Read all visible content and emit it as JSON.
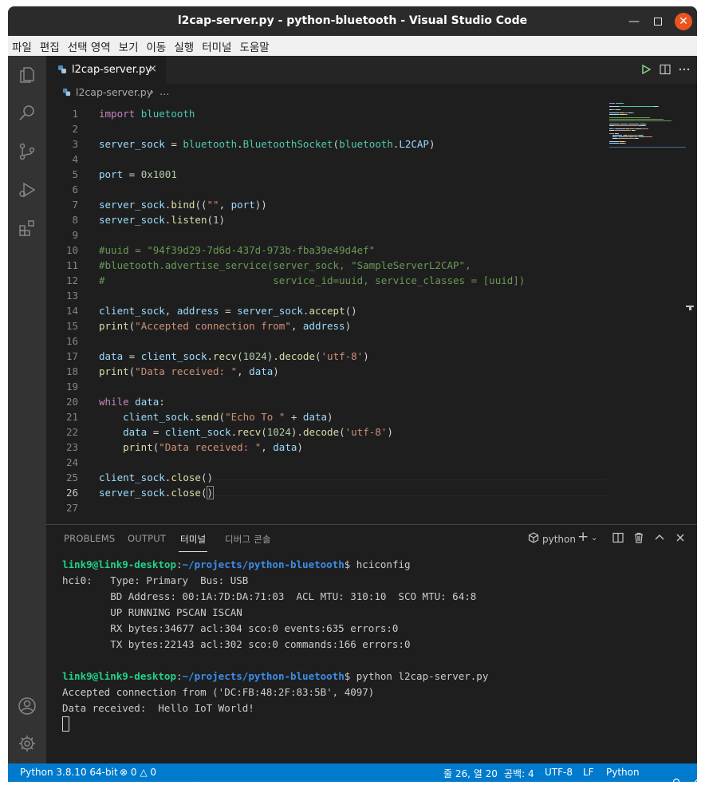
{
  "window": {
    "title": "l2cap-server.py - python-bluetooth - Visual Studio Code"
  },
  "menu": [
    "파일",
    "편집",
    "선택 영역",
    "보기",
    "이동",
    "실행",
    "터미널",
    "도움말"
  ],
  "activity_bar": [
    "files-icon",
    "search-icon",
    "source-control-icon",
    "run-debug-icon",
    "extensions-icon",
    "account-icon",
    "settings-gear-icon"
  ],
  "tab": {
    "label": "l2cap-server.py",
    "close": "×"
  },
  "breadcrumb": {
    "file": "l2cap-server.py",
    "separator": "›",
    "more": "…"
  },
  "editor": {
    "lines": [
      [
        [
          "k",
          "import"
        ],
        [
          "p",
          " "
        ],
        [
          "m",
          "bluetooth"
        ]
      ],
      [],
      [
        [
          "v",
          "server_sock"
        ],
        [
          "p",
          " = "
        ],
        [
          "m",
          "bluetooth"
        ],
        [
          "p",
          "."
        ],
        [
          "m",
          "BluetoothSocket"
        ],
        [
          "p",
          "("
        ],
        [
          "m",
          "bluetooth"
        ],
        [
          "p",
          "."
        ],
        [
          "v",
          "L2CAP"
        ],
        [
          "p",
          ")"
        ]
      ],
      [],
      [
        [
          "v",
          "port"
        ],
        [
          "p",
          " = "
        ],
        [
          "n",
          "0x1001"
        ]
      ],
      [],
      [
        [
          "v",
          "server_sock"
        ],
        [
          "p",
          "."
        ],
        [
          "f",
          "bind"
        ],
        [
          "p",
          "(("
        ],
        [
          "s",
          "\"\""
        ],
        [
          "p",
          ", "
        ],
        [
          "v",
          "port"
        ],
        [
          "p",
          "))"
        ]
      ],
      [
        [
          "v",
          "server_sock"
        ],
        [
          "p",
          "."
        ],
        [
          "f",
          "listen"
        ],
        [
          "p",
          "("
        ],
        [
          "n",
          "1"
        ],
        [
          "p",
          ")"
        ]
      ],
      [],
      [
        [
          "c",
          "#uuid = \"94f39d29-7d6d-437d-973b-fba39e49d4ef\""
        ]
      ],
      [
        [
          "c",
          "#bluetooth.advertise_service(server_sock, \"SampleServerL2CAP\","
        ]
      ],
      [
        [
          "c",
          "#                            service_id=uuid, service_classes = [uuid])"
        ]
      ],
      [],
      [
        [
          "v",
          "client_sock"
        ],
        [
          "p",
          ", "
        ],
        [
          "v",
          "address"
        ],
        [
          "p",
          " = "
        ],
        [
          "v",
          "server_sock"
        ],
        [
          "p",
          "."
        ],
        [
          "f",
          "accept"
        ],
        [
          "p",
          "()"
        ]
      ],
      [
        [
          "f",
          "print"
        ],
        [
          "p",
          "("
        ],
        [
          "s",
          "\"Accepted connection from\""
        ],
        [
          "p",
          ", "
        ],
        [
          "v",
          "address"
        ],
        [
          "p",
          ")"
        ]
      ],
      [],
      [
        [
          "v",
          "data"
        ],
        [
          "p",
          " = "
        ],
        [
          "v",
          "client_sock"
        ],
        [
          "p",
          "."
        ],
        [
          "f",
          "recv"
        ],
        [
          "p",
          "("
        ],
        [
          "n",
          "1024"
        ],
        [
          "p",
          ")."
        ],
        [
          "f",
          "decode"
        ],
        [
          "p",
          "("
        ],
        [
          "s",
          "'utf-8'"
        ],
        [
          "p",
          ")"
        ]
      ],
      [
        [
          "f",
          "print"
        ],
        [
          "p",
          "("
        ],
        [
          "s",
          "\"Data received: \""
        ],
        [
          "p",
          ", "
        ],
        [
          "v",
          "data"
        ],
        [
          "p",
          ")"
        ]
      ],
      [],
      [
        [
          "k",
          "while"
        ],
        [
          "p",
          " "
        ],
        [
          "v",
          "data"
        ],
        [
          "p",
          ":"
        ]
      ],
      [
        [
          "p",
          "    "
        ],
        [
          "v",
          "client_sock"
        ],
        [
          "p",
          "."
        ],
        [
          "f",
          "send"
        ],
        [
          "p",
          "("
        ],
        [
          "s",
          "\"Echo To \""
        ],
        [
          "p",
          " + "
        ],
        [
          "v",
          "data"
        ],
        [
          "p",
          ")"
        ]
      ],
      [
        [
          "p",
          "    "
        ],
        [
          "v",
          "data"
        ],
        [
          "p",
          " = "
        ],
        [
          "v",
          "client_sock"
        ],
        [
          "p",
          "."
        ],
        [
          "f",
          "recv"
        ],
        [
          "p",
          "("
        ],
        [
          "n",
          "1024"
        ],
        [
          "p",
          ")."
        ],
        [
          "f",
          "decode"
        ],
        [
          "p",
          "("
        ],
        [
          "s",
          "'utf-8'"
        ],
        [
          "p",
          ")"
        ]
      ],
      [
        [
          "p",
          "    "
        ],
        [
          "f",
          "print"
        ],
        [
          "p",
          "("
        ],
        [
          "s",
          "\"Data received: \""
        ],
        [
          "p",
          ", "
        ],
        [
          "v",
          "data"
        ],
        [
          "p",
          ")"
        ]
      ],
      [],
      [
        [
          "v",
          "client_sock"
        ],
        [
          "p",
          "."
        ],
        [
          "f",
          "close"
        ],
        [
          "p",
          "()"
        ]
      ],
      [
        [
          "v",
          "server_sock"
        ],
        [
          "p",
          "."
        ],
        [
          "f",
          "close"
        ],
        [
          "p",
          "("
        ],
        [
          "bm",
          ")"
        ]
      ],
      []
    ],
    "line_numbers": [
      "1",
      "2",
      "3",
      "4",
      "5",
      "6",
      "7",
      "8",
      "9",
      "10",
      "11",
      "12",
      "13",
      "14",
      "15",
      "16",
      "17",
      "18",
      "19",
      "20",
      "21",
      "22",
      "23",
      "24",
      "25",
      "26",
      "27"
    ],
    "active_line": 26
  },
  "panel": {
    "tabs": [
      "PROBLEMS",
      "OUTPUT",
      "터미널",
      "디버그 콘솔"
    ],
    "active_tab": "터미널",
    "shell": "python",
    "terminal_lines": [
      [
        [
          "tg",
          "link9@link9-desktop"
        ],
        [
          "p",
          ":"
        ],
        [
          "tb",
          "~/projects/python-bluetooth"
        ],
        [
          "p",
          "$ hciconfig"
        ]
      ],
      [
        [
          "p",
          "hci0:   Type: Primary  Bus: USB"
        ]
      ],
      [
        [
          "p",
          "        BD Address: 00:1A:7D:DA:71:03  ACL MTU: 310:10  SCO MTU: 64:8"
        ]
      ],
      [
        [
          "p",
          "        UP RUNNING PSCAN ISCAN"
        ]
      ],
      [
        [
          "p",
          "        RX bytes:34677 acl:304 sco:0 events:635 errors:0"
        ]
      ],
      [
        [
          "p",
          "        TX bytes:22143 acl:302 sco:0 commands:166 errors:0"
        ]
      ],
      [],
      [
        [
          "tg",
          "link9@link9-desktop"
        ],
        [
          "p",
          ":"
        ],
        [
          "tb",
          "~/projects/python-bluetooth"
        ],
        [
          "p",
          "$ python l2cap-server.py"
        ]
      ],
      [
        [
          "p",
          "Accepted connection from ('DC:FB:48:2F:83:5B', 4097)"
        ]
      ],
      [
        [
          "p",
          "Data received:  Hello IoT World!"
        ]
      ]
    ]
  },
  "statusbar": {
    "interpreter": "Python 3.8.10 64-bit",
    "errors": "0",
    "warnings": "0",
    "position": "줄 26, 열 20",
    "indent": "공백: 4",
    "encoding": "UTF-8",
    "eol": "LF",
    "language": "Python"
  },
  "colors": {
    "statusbar": "#007acc",
    "activitybar": "#333333",
    "editor_bg": "#1e1e1e",
    "close_button": "#e95420"
  }
}
